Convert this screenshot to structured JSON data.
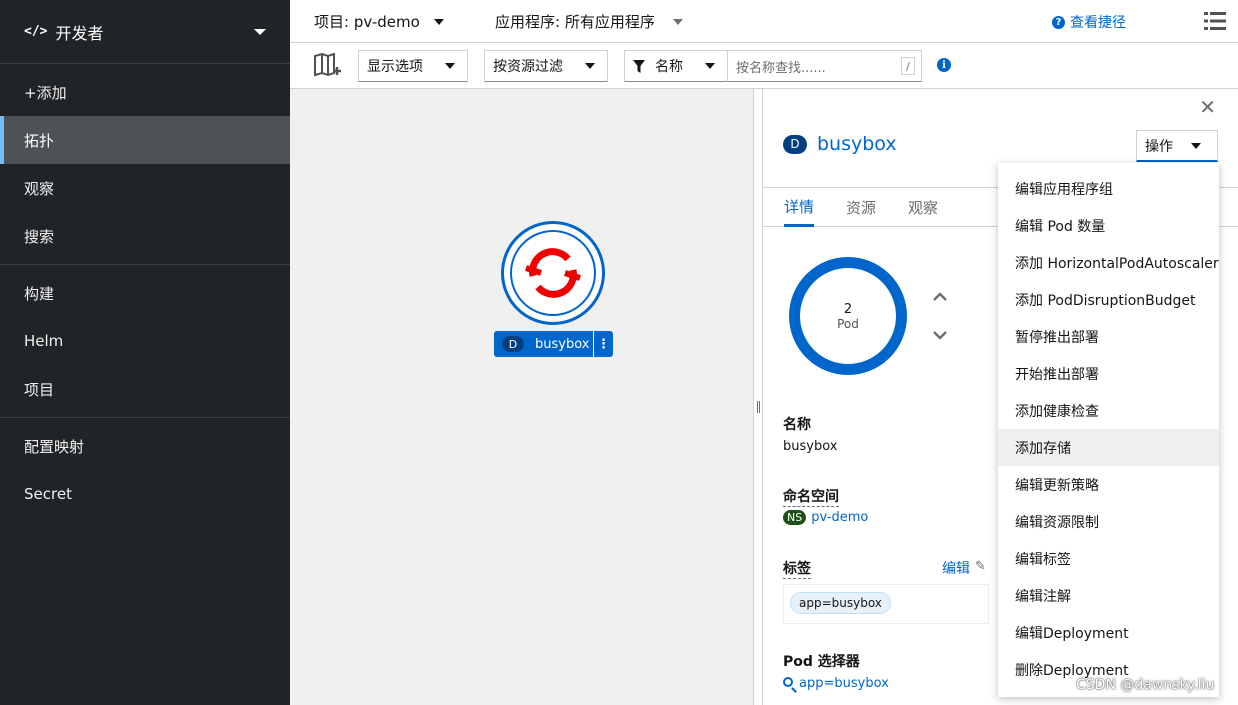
{
  "sidebar": {
    "perspective": "开发者",
    "groups": [
      [
        "+添加",
        "拓扑",
        "观察",
        "搜索"
      ],
      [
        "构建",
        "Helm",
        "项目"
      ],
      [
        "配置映射",
        "Secret"
      ]
    ],
    "active": "拓扑"
  },
  "topbar": {
    "project": "项目: pv-demo",
    "application": "应用程序: 所有应用程序",
    "help_link": "查看捷径"
  },
  "toolbar": {
    "display_options": "显示选项",
    "filter_by_resource": "按资源过滤",
    "name_filter": "名称",
    "search_placeholder": "按名称查找......",
    "search_shortcut": "/"
  },
  "node": {
    "badge": "D",
    "name": "busybox"
  },
  "panel": {
    "badge": "D",
    "title": "busybox",
    "actions_label": "操作",
    "tabs": [
      "详情",
      "资源",
      "观察"
    ],
    "pod_count": "2",
    "pod_unit": "Pod",
    "fields": {
      "name_label": "名称",
      "name_value": "busybox",
      "namespace_label": "命名空间",
      "namespace_badge": "NS",
      "namespace_value": "pv-demo",
      "labels_label": "标签",
      "edit_label": "编辑",
      "label_chip": "app=busybox",
      "pod_selector_label": "Pod 选择器",
      "pod_selector_value": "app=busybox"
    }
  },
  "menu": {
    "items": [
      "编辑应用程序组",
      "编辑 Pod 数量",
      "添加 HorizontalPodAutoscaler",
      "添加 PodDisruptionBudget",
      "暂停推出部署",
      "开始推出部署",
      "添加健康检查",
      "添加存储",
      "编辑更新策略",
      "编辑资源限制",
      "编辑标签",
      "编辑注解",
      "编辑Deployment",
      "删除Deployment"
    ],
    "highlighted": "添加存储"
  },
  "watermark": "CSDN @dawnsky.liu",
  "colors": {
    "sidebar_bg": "#212427",
    "accent": "#0066cc",
    "namespace_badge": "#1e4f18"
  }
}
